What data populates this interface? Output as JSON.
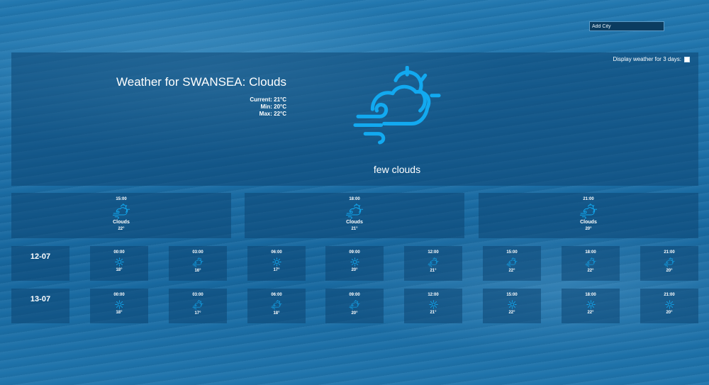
{
  "search": {
    "placeholder": "Add City"
  },
  "toggle": {
    "label": "Display weather for 3 days:"
  },
  "current": {
    "title": "Weather for SWANSEA: Clouds",
    "current": "Current: 21°C",
    "min": "Min: 20°C",
    "max": "Max: 22°C",
    "icon": "cloud-sun-wind-icon",
    "description": "few clouds"
  },
  "today": [
    {
      "time": "15:00",
      "icon": "cloud-sun-wind-icon",
      "condition": "Clouds",
      "temp": "22°"
    },
    {
      "time": "18:00",
      "icon": "cloud-sun-wind-icon",
      "condition": "Clouds",
      "temp": "21°"
    },
    {
      "time": "21:00",
      "icon": "cloud-sun-wind-icon",
      "condition": "Clouds",
      "temp": "20°"
    }
  ],
  "days": [
    {
      "date": "12-07",
      "slots": [
        {
          "time": "00:00",
          "icon": "sun-icon",
          "temp": "18°"
        },
        {
          "time": "03:00",
          "icon": "cloud-sun-wind-icon",
          "temp": "16°"
        },
        {
          "time": "06:00",
          "icon": "sun-icon",
          "temp": "17°"
        },
        {
          "time": "09:00",
          "icon": "sun-icon",
          "temp": "20°"
        },
        {
          "time": "12:00",
          "icon": "cloud-sun-wind-icon",
          "temp": "21°"
        },
        {
          "time": "15:00",
          "icon": "cloud-sun-wind-icon",
          "temp": "22°"
        },
        {
          "time": "18:00",
          "icon": "cloud-sun-wind-icon",
          "temp": "22°"
        },
        {
          "time": "21:00",
          "icon": "cloud-sun-wind-icon",
          "temp": "20°"
        }
      ]
    },
    {
      "date": "13-07",
      "slots": [
        {
          "time": "00:00",
          "icon": "sun-icon",
          "temp": "18°"
        },
        {
          "time": "03:00",
          "icon": "cloud-sun-wind-icon",
          "temp": "17°"
        },
        {
          "time": "06:00",
          "icon": "cloud-sun-wind-icon",
          "temp": "18°"
        },
        {
          "time": "09:00",
          "icon": "cloud-sun-wind-icon",
          "temp": "20°"
        },
        {
          "time": "12:00",
          "icon": "sun-icon",
          "temp": "21°"
        },
        {
          "time": "15:00",
          "icon": "sun-icon",
          "temp": "22°"
        },
        {
          "time": "18:00",
          "icon": "sun-icon",
          "temp": "22°"
        },
        {
          "time": "21:00",
          "icon": "sun-icon",
          "temp": "20°"
        }
      ]
    }
  ],
  "colors": {
    "icon": "#12a9f0"
  }
}
